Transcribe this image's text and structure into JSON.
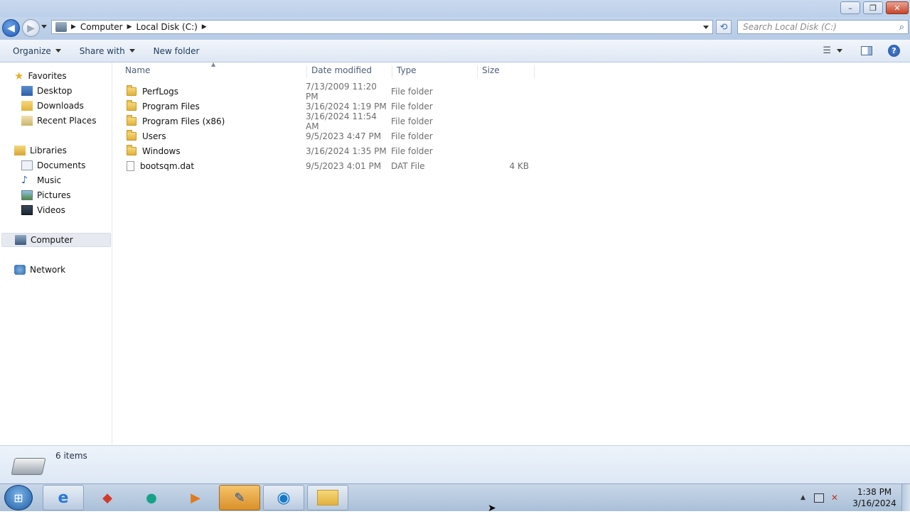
{
  "window": {
    "minimize": "–",
    "maximize": "❐",
    "close": "✕"
  },
  "nav": {
    "breadcrumbs": [
      "Computer",
      "Local Disk (C:)"
    ],
    "search_placeholder": "Search Local Disk (C:)"
  },
  "toolbar": {
    "organize": "Organize",
    "share_with": "Share with",
    "new_folder": "New folder"
  },
  "sidebar": {
    "favorites": {
      "label": "Favorites",
      "items": [
        "Desktop",
        "Downloads",
        "Recent Places"
      ]
    },
    "libraries": {
      "label": "Libraries",
      "items": [
        "Documents",
        "Music",
        "Pictures",
        "Videos"
      ]
    },
    "computer": "Computer",
    "network": "Network"
  },
  "columns": [
    "Name",
    "Date modified",
    "Type",
    "Size"
  ],
  "files": [
    {
      "name": "PerfLogs",
      "date": "7/13/2009 11:20 PM",
      "type": "File folder",
      "size": "",
      "icon": "folder-icon"
    },
    {
      "name": "Program Files",
      "date": "3/16/2024 1:19 PM",
      "type": "File folder",
      "size": "",
      "icon": "folder-icon"
    },
    {
      "name": "Program Files (x86)",
      "date": "3/16/2024 11:54 AM",
      "type": "File folder",
      "size": "",
      "icon": "folder-icon"
    },
    {
      "name": "Users",
      "date": "9/5/2023 4:47 PM",
      "type": "File folder",
      "size": "",
      "icon": "folder-icon"
    },
    {
      "name": "Windows",
      "date": "3/16/2024 1:35 PM",
      "type": "File folder",
      "size": "",
      "icon": "folder-icon"
    },
    {
      "name": "bootsqm.dat",
      "date": "9/5/2023 4:01 PM",
      "type": "DAT File",
      "size": "4 KB",
      "icon": "file-icon"
    }
  ],
  "status": {
    "item_count": "6 items"
  },
  "taskbar": {
    "time": "1:38 PM",
    "date": "3/16/2024"
  }
}
